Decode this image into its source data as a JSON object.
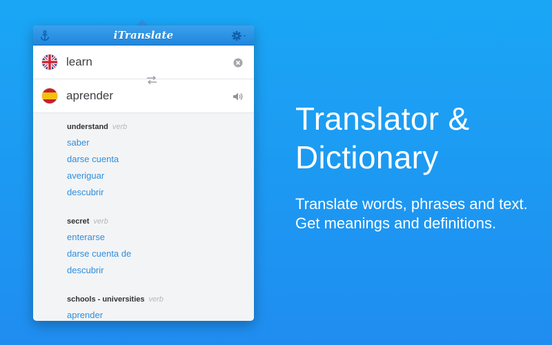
{
  "app": {
    "title": "iTranslate",
    "left_icon": "anchor-icon",
    "right_icon": "gear-icon"
  },
  "source": {
    "language_icon": "uk-flag-icon",
    "text": "learn",
    "action_icon": "clear-icon"
  },
  "swap_icon": "swap-languages-icon",
  "target": {
    "language_icon": "spain-flag-icon",
    "text": "aprender",
    "action_icon": "speaker-icon"
  },
  "results": [
    {
      "term": "understand",
      "pos": "verb",
      "meanings": [
        "saber",
        "darse cuenta",
        "averiguar",
        "descubrir"
      ]
    },
    {
      "term": "secret",
      "pos": "verb",
      "meanings": [
        "enterarse",
        "darse cuenta de",
        "descubrir"
      ]
    },
    {
      "term": "schools - universities",
      "pos": "verb",
      "meanings": [
        "aprender"
      ]
    }
  ],
  "marketing": {
    "headline_line1": "Translator &",
    "headline_line2": "Dictionary",
    "subtext": "Translate words, phrases and text. Get meanings and definitions."
  },
  "colors": {
    "background": "#1f9af2",
    "titlebar": "#2a90e3",
    "link": "#2e8edd",
    "text": "#3c3f44",
    "muted": "#b4b8bd"
  }
}
